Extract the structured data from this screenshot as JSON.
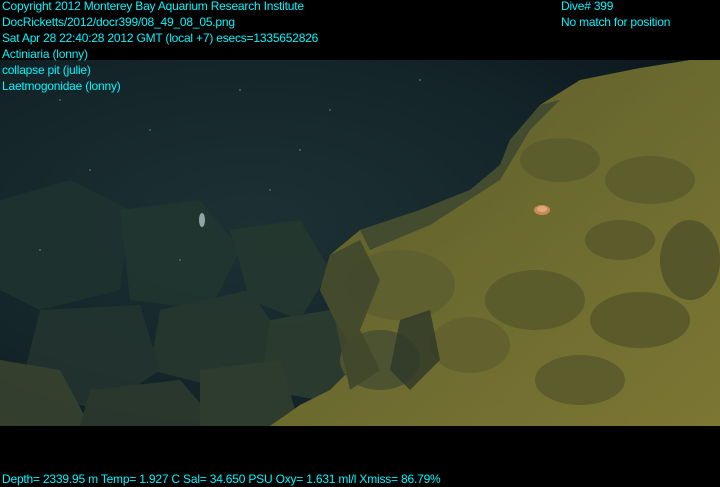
{
  "overlay": {
    "header_left": [
      "Copyright 2012 Monterey Bay Aquarium Research Institute",
      "DocRicketts/2012/docr399/08_49_08_05.png",
      "Sat Apr 28 22:40:28 2012 GMT (local +7)  esecs=1335652826",
      "Actiniaria (lonny)",
      "collapse pit (julie)",
      "Laetmogonidae (lonny)"
    ],
    "header_right": [
      "Dive# 399",
      "No match for position"
    ],
    "footer": "Depth= 2339.95 m  Temp= 1.927 C  Sal= 34.650 PSU  Oxy= 1.631 ml/l  Xmiss= 86.79%"
  },
  "colors": {
    "overlay_text": "#00f6ff",
    "background": "#000000",
    "water": "#17282c",
    "seafloor": "#6f6a2e"
  }
}
